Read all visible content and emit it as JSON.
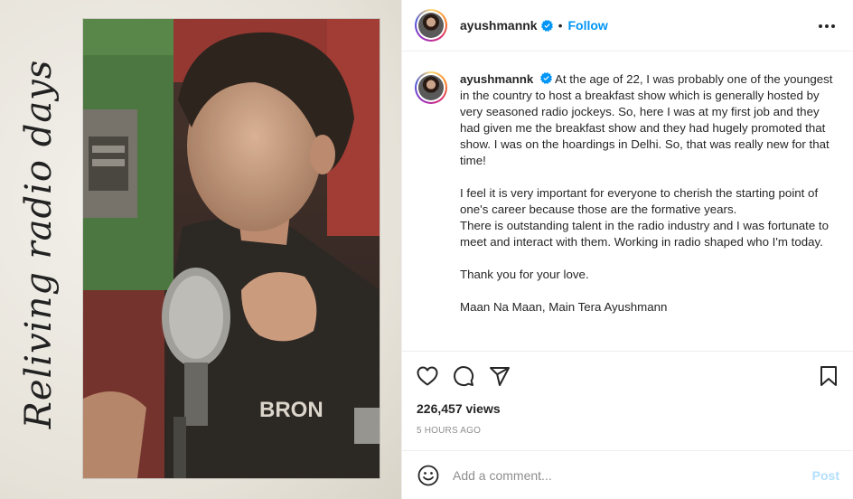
{
  "media": {
    "script_text": "Reliving radio days",
    "shirt_text": "BRON"
  },
  "header": {
    "username": "ayushmannk",
    "separator": "•",
    "follow_label": "Follow"
  },
  "caption": {
    "username": "ayushmannk",
    "para1": "At the age of 22, I was probably one of the youngest in the country to host a breakfast show which is generally hosted by very seasoned radio jockeys. So, here I was at my first job and they had given me the breakfast show and they had hugely promoted that show. I was on the hoardings in Delhi. So, that was really new for that time!",
    "para2a": "I feel it is very important for everyone to cherish the starting point of one's career because those are the formative years.",
    "para2b": "There is outstanding talent in the radio industry and I was fortunate to meet and interact with them. Working in radio shaped who I'm today.",
    "para3": "Thank you for your love.",
    "para4": "Maan Na Maan, Main Tera Ayushmann"
  },
  "stats": {
    "views": "226,457 views",
    "time": "5 HOURS AGO"
  },
  "comment": {
    "placeholder": "Add a comment...",
    "post_label": "Post"
  },
  "colors": {
    "accent": "#0095f6",
    "post_disabled": "#b2dffc",
    "muted": "#8e8e8e"
  },
  "icons": [
    "verified-icon",
    "more-icon",
    "heart-icon",
    "comment-icon",
    "share-icon",
    "bookmark-icon",
    "emoji-icon"
  ]
}
